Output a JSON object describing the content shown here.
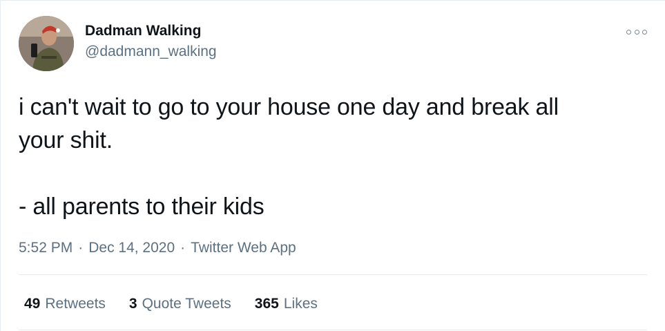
{
  "author": {
    "display_name": "Dadman Walking",
    "handle": "@dadmann_walking",
    "avatar_icon": "profile-photo"
  },
  "tweet": {
    "text": "i can't wait to go to your house one day and break all\nyour shit.\n\n- all parents to their kids"
  },
  "meta": {
    "time": "5:52 PM",
    "separator": "·",
    "date": "Dec 14, 2020",
    "app": "Twitter Web App"
  },
  "stats": [
    {
      "count": "49",
      "label": "Retweets"
    },
    {
      "count": "3",
      "label": "Quote Tweets"
    },
    {
      "count": "365",
      "label": "Likes"
    }
  ],
  "icons": {
    "more": "more-options-icon"
  },
  "colors": {
    "text": "#0f1419",
    "secondary": "#5b7083",
    "border": "#e6ecf0"
  }
}
